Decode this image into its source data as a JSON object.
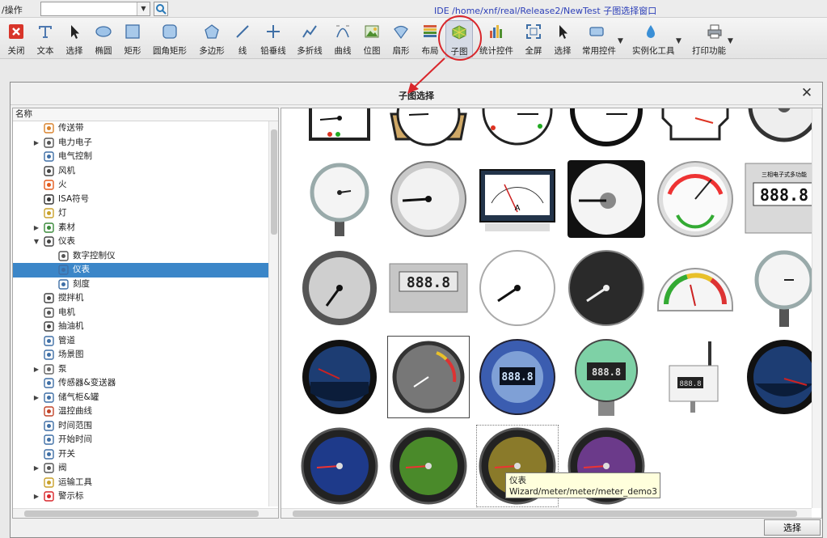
{
  "topbar": {
    "menu_label": "/操作",
    "search_value": "",
    "window_title": "IDE /home/xnf/real/Release2/NewTest  子图选择窗口"
  },
  "toolbar": {
    "items": [
      {
        "label": "关闭",
        "icon": "close-icon"
      },
      {
        "label": "文本",
        "icon": "text-icon"
      },
      {
        "label": "选择",
        "icon": "cursor-icon"
      },
      {
        "label": "椭圆",
        "icon": "ellipse-icon"
      },
      {
        "label": "矩形",
        "icon": "rect-icon"
      },
      {
        "label": "圆角矩形",
        "icon": "rounded-rect-icon"
      },
      {
        "label": "多边形",
        "icon": "polygon-icon"
      },
      {
        "label": "线",
        "icon": "line-icon"
      },
      {
        "label": "铅垂线",
        "icon": "plumb-line-icon"
      },
      {
        "label": "多折线",
        "icon": "polyline-icon"
      },
      {
        "label": "曲线",
        "icon": "curve-icon"
      },
      {
        "label": "位图",
        "icon": "bitmap-icon"
      },
      {
        "label": "扇形",
        "icon": "sector-icon"
      },
      {
        "label": "布局",
        "icon": "layout-icon"
      },
      {
        "label": "子图",
        "icon": "subchart-icon"
      },
      {
        "label": "统计控件",
        "icon": "stats-icon"
      },
      {
        "label": "全屏",
        "icon": "fullscreen-icon"
      },
      {
        "label": "选择",
        "icon": "cursor-icon"
      },
      {
        "label": "常用控件",
        "icon": "common-controls-icon"
      },
      {
        "label": "实例化工具",
        "icon": "instantiate-icon"
      },
      {
        "label": "打印功能",
        "icon": "print-icon"
      }
    ]
  },
  "dialog": {
    "title": "子图选择",
    "tree_header": "名称",
    "tree": [
      {
        "label": "传送带",
        "icon": "conveyor-icon",
        "level": 1,
        "expander": ""
      },
      {
        "label": "电力电子",
        "icon": "power-electronics-icon",
        "level": 1,
        "expander": "▶"
      },
      {
        "label": "电气控制",
        "icon": "electric-control-icon",
        "level": 1,
        "expander": ""
      },
      {
        "label": "风机",
        "icon": "fan-icon",
        "level": 1,
        "expander": ""
      },
      {
        "label": "火",
        "icon": "fire-icon",
        "level": 1,
        "expander": ""
      },
      {
        "label": "ISA符号",
        "icon": "isa-symbol-icon",
        "level": 1,
        "expander": ""
      },
      {
        "label": "灯",
        "icon": "lamp-icon",
        "level": 1,
        "expander": ""
      },
      {
        "label": "素材",
        "icon": "material-icon",
        "level": 1,
        "expander": "▶"
      },
      {
        "label": "仪表",
        "icon": "instrument-icon",
        "level": 1,
        "expander": "▼"
      },
      {
        "label": "数字控制仪",
        "icon": "digital-controller-icon",
        "level": 2,
        "expander": ""
      },
      {
        "label": "仪表",
        "icon": "meter-icon",
        "level": 2,
        "expander": "",
        "selected": true
      },
      {
        "label": "刻度",
        "icon": "scale-icon",
        "level": 2,
        "expander": ""
      },
      {
        "label": "搅拌机",
        "icon": "mixer-icon",
        "level": 1,
        "expander": ""
      },
      {
        "label": "电机",
        "icon": "motor-icon",
        "level": 1,
        "expander": ""
      },
      {
        "label": "抽油机",
        "icon": "pump-jack-icon",
        "level": 1,
        "expander": ""
      },
      {
        "label": "管道",
        "icon": "pipe-icon",
        "level": 1,
        "expander": ""
      },
      {
        "label": "场景图",
        "icon": "scene-icon",
        "level": 1,
        "expander": ""
      },
      {
        "label": "泵",
        "icon": "pump-icon",
        "level": 1,
        "expander": "▶"
      },
      {
        "label": "传感器&变送器",
        "icon": "sensor-icon",
        "level": 1,
        "expander": ""
      },
      {
        "label": "储气柜&罐",
        "icon": "tank-icon",
        "level": 1,
        "expander": "▶"
      },
      {
        "label": "温控曲线",
        "icon": "temperature-curve-icon",
        "level": 1,
        "expander": ""
      },
      {
        "label": "时间范围",
        "icon": "clock-icon",
        "level": 1,
        "expander": ""
      },
      {
        "label": "开始时间",
        "icon": "clock-icon",
        "level": 1,
        "expander": ""
      },
      {
        "label": "开关",
        "icon": "switch-icon",
        "level": 1,
        "expander": ""
      },
      {
        "label": "阀",
        "icon": "valve-icon",
        "level": 1,
        "expander": "▶"
      },
      {
        "label": "运输工具",
        "icon": "transport-icon",
        "level": 1,
        "expander": ""
      },
      {
        "label": "警示标",
        "icon": "warning-sign-icon",
        "level": 1,
        "expander": "▶"
      }
    ],
    "gallery_labels": {
      "ammeter_unit": "A",
      "display_digits": "888.8",
      "panel_caption": "三相电子式多功能",
      "sensor_digits": "888.8"
    },
    "tooltip": {
      "line1": "仪表",
      "line2": "Wizard/meter/meter/meter_demo3"
    },
    "select_button": "选择"
  }
}
